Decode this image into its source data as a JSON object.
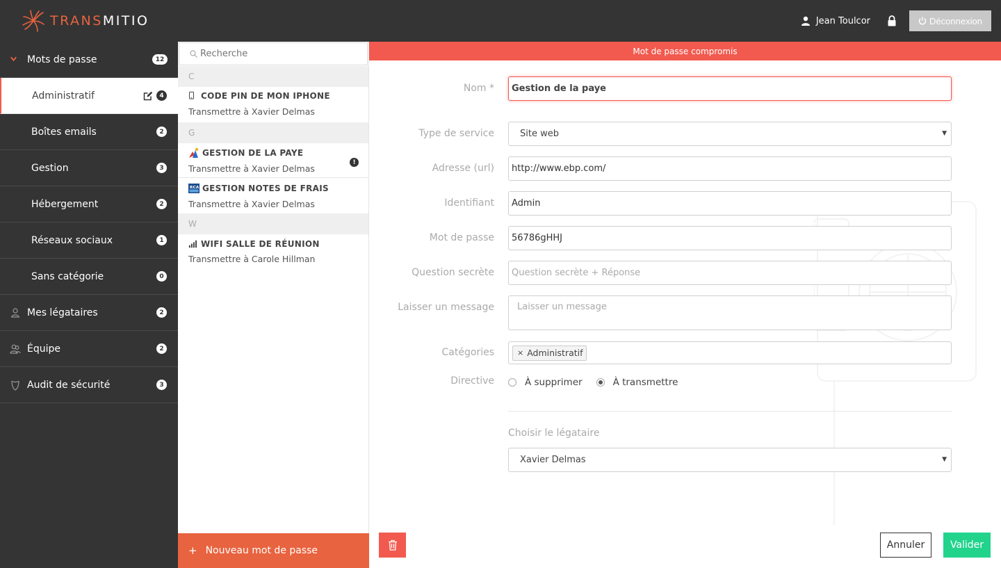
{
  "app": {
    "logo_accent": "TRANS",
    "logo_rest": "MITIO",
    "logo_icon": "sun-spiral-logo"
  },
  "header": {
    "user_icon": "user-icon",
    "user_name": "Jean Toulcor",
    "lock_icon": "lock-icon",
    "logout_label": "Déconnexion",
    "logout_icon": "power-icon"
  },
  "sidebar": {
    "items": [
      {
        "label": "Mots de passe",
        "count": "12",
        "icon": "chevron-down-icon"
      },
      {
        "label": "Administratif",
        "count": "4",
        "icon": "edit-icon",
        "active": true
      },
      {
        "label": "Boîtes emails",
        "count": "2"
      },
      {
        "label": "Gestion",
        "count": "3"
      },
      {
        "label": "Hébergement",
        "count": "2"
      },
      {
        "label": "Réseaux sociaux",
        "count": "1"
      },
      {
        "label": "Sans catégorie",
        "count": "0"
      },
      {
        "label": "Mes légataires",
        "count": "2",
        "icon": "heir-icon"
      },
      {
        "label": "Équipe",
        "count": "2",
        "icon": "team-icon"
      },
      {
        "label": "Audit de sécurité",
        "count": "3",
        "icon": "shield-icon"
      }
    ]
  },
  "list": {
    "search_placeholder": "Recherche",
    "groups": [
      {
        "letter": "C",
        "entries": [
          {
            "title": "CODE PIN DE MON IPHONE",
            "subtitle": "Transmettre à Xavier Delmas",
            "icon": "phone-icon"
          }
        ]
      },
      {
        "letter": "G",
        "entries": [
          {
            "title": "GESTION DE LA PAYE",
            "subtitle": "Transmettre à Xavier Delmas",
            "icon": "ebp-logo-icon",
            "warning": "!"
          },
          {
            "title": "GESTION NOTES DE FRAIS",
            "subtitle": "Transmettre à Xavier Delmas",
            "icon": "rca-logo-icon"
          }
        ]
      },
      {
        "letter": "W",
        "entries": [
          {
            "title": "WIFI SALLE DE RÉUNION",
            "subtitle": "Transmettre à Carole Hillman",
            "icon": "signal-icon"
          }
        ]
      }
    ],
    "new_button": "Nouveau mot de passe",
    "new_button_prefix": "+"
  },
  "detail": {
    "alert": "Mot de passe compromis",
    "fields": {
      "name_label": "Nom *",
      "name_value": "Gestion de la paye",
      "service_label": "Type de service",
      "service_value": "Site web",
      "url_label": "Adresse (url)",
      "url_value": "http://www.ebp.com/",
      "login_label": "Identifiant",
      "login_value": "Admin",
      "password_label": "Mot de passe",
      "password_value": "56786gHHJ",
      "question_label": "Question secrète",
      "question_placeholder": "Question secrète + Réponse",
      "message_label": "Laisser un message",
      "message_placeholder": "Laisser un message",
      "categories_label": "Catégories",
      "category_tag": "Administratif",
      "category_tag_remove": "×",
      "directive_label": "Directive",
      "directive_delete": "À supprimer",
      "directive_transmit": "À transmettre",
      "directive_selected": "À transmettre",
      "heir_label": "Choisir le légataire",
      "heir_value": "Xavier Delmas"
    },
    "buttons": {
      "delete_icon": "trash-icon",
      "cancel": "Annuler",
      "submit": "Valider"
    },
    "colors": {
      "alert": "#f25a4f",
      "accent": "#e8633f",
      "submit": "#22d38c",
      "dark": "#343434"
    }
  }
}
